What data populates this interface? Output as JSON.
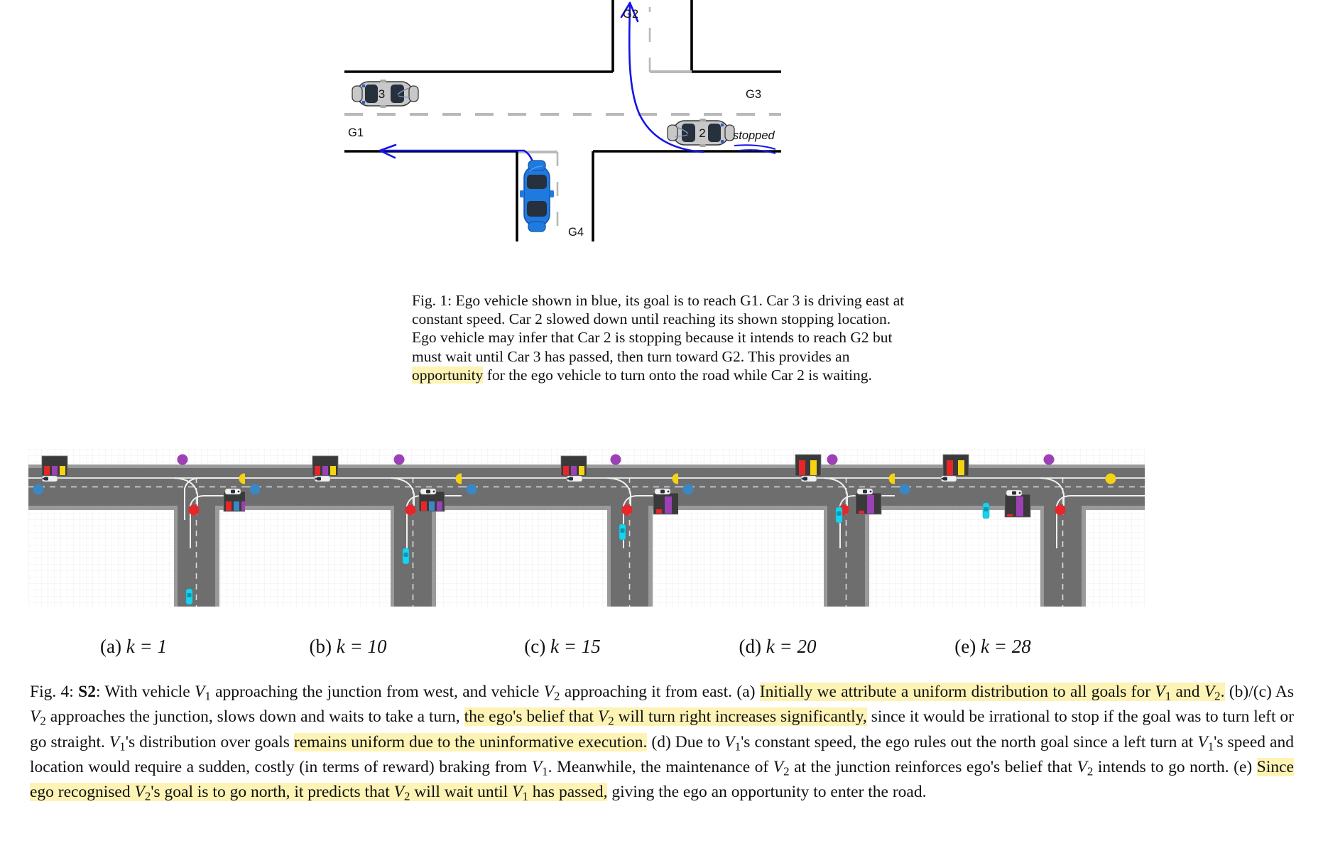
{
  "figure1": {
    "goal_labels": {
      "g1": "G1",
      "g2": "G2",
      "g3": "G3",
      "g4": "G4"
    },
    "cars": [
      {
        "id": "car-3",
        "number": "3",
        "color": "#b8b8b8",
        "heading": "east"
      },
      {
        "id": "car-2",
        "number": "2",
        "color": "#b8b8b8",
        "heading": "west"
      },
      {
        "id": "ego-car",
        "number": "",
        "color": "#1f7ae0",
        "heading": "north"
      }
    ],
    "annotation_stopped": "stopped",
    "arrow_color": "#1414e6",
    "caption": {
      "label": "Fig. 1:",
      "part1": " Ego vehicle shown in blue, its goal is to reach G1. Car 3 is driving east at constant speed. Car 2 slowed down until reaching its shown stopping location. Ego vehicle may infer that Car 2 is stopping because it intends to reach G2 but must wait until Car 3 has passed, then turn toward G2. This provides an ",
      "highlight": "opportunity",
      "part2": " for the ego vehicle to turn onto the road while Car 2 is waiting."
    }
  },
  "figure4": {
    "subcaptions": [
      {
        "tag": "(a)",
        "expr": "k = 1",
        "k": 1
      },
      {
        "tag": "(b)",
        "expr": "k = 10",
        "k": 10
      },
      {
        "tag": "(c)",
        "expr": "k = 15",
        "k": 15
      },
      {
        "tag": "(d)",
        "expr": "k = 20",
        "k": 20
      },
      {
        "tag": "(e)",
        "expr": "k = 28",
        "k": 28
      }
    ],
    "legend_colors": {
      "road": "#6e6e6e",
      "shoulder": "#9a9a9a",
      "lane_marking": "#dcdcdc",
      "ego_vehicle": "#19d2ee",
      "other_vehicle": "#f2f2f2",
      "goal_marker_yellow": "#f5d312",
      "goal_marker_blue": "#3a87c4",
      "goal_marker_red": "#e8262a",
      "goal_marker_purple": "#9c41b5",
      "belief_panel_bg": "#3a3a3a"
    },
    "panels": [
      {
        "name": "panel-a",
        "goals": [
          {
            "name": "goal-north",
            "color": "#9c41b5"
          },
          {
            "name": "goal-east",
            "color": "#f5d312"
          },
          {
            "name": "goal-west",
            "color": "#3a87c4"
          },
          {
            "name": "goal-south",
            "color": "#e8262a"
          }
        ],
        "beliefs_v1": [
          {
            "goal": "red",
            "value": 0.33
          },
          {
            "goal": "purple",
            "value": 0.33
          },
          {
            "goal": "yellow",
            "value": 0.33
          }
        ],
        "beliefs_v2": [
          {
            "goal": "red",
            "value": 0.33
          },
          {
            "goal": "blue",
            "value": 0.33
          },
          {
            "goal": "purple",
            "value": 0.33
          }
        ],
        "v1_x": 0.06,
        "v2_x": 0.8,
        "ego_y": 0.88
      },
      {
        "name": "panel-b",
        "beliefs_v1": [
          {
            "goal": "red",
            "value": 0.33
          },
          {
            "goal": "purple",
            "value": 0.33
          },
          {
            "goal": "yellow",
            "value": 0.33
          }
        ],
        "beliefs_v2": [
          {
            "goal": "red",
            "value": 0.33
          },
          {
            "goal": "blue",
            "value": 0.33
          },
          {
            "goal": "purple",
            "value": 0.33
          }
        ],
        "v1_x": 0.32,
        "v2_x": 0.68,
        "ego_y": 0.64
      },
      {
        "name": "panel-c",
        "beliefs_v1": [
          {
            "goal": "red",
            "value": 0.33
          },
          {
            "goal": "purple",
            "value": 0.33
          },
          {
            "goal": "yellow",
            "value": 0.33
          }
        ],
        "beliefs_v2": [
          {
            "goal": "red",
            "value": 0.18
          },
          {
            "goal": "purple",
            "value": 0.8
          }
        ],
        "v1_x": 0.46,
        "v2_x": 0.58,
        "ego_y": 0.56
      },
      {
        "name": "panel-d",
        "beliefs_v1": [
          {
            "goal": "red",
            "value": 0.5
          },
          {
            "goal": "yellow",
            "value": 0.5
          }
        ],
        "beliefs_v2": [
          {
            "goal": "red",
            "value": 0.16
          },
          {
            "goal": "purple",
            "value": 0.88
          }
        ],
        "v1_x": 0.56,
        "v2_x": 0.56,
        "ego_y": 0.5
      },
      {
        "name": "panel-e",
        "beliefs_v1": [
          {
            "goal": "red",
            "value": 0.52
          },
          {
            "goal": "yellow",
            "value": 0.52
          }
        ],
        "beliefs_v2": [
          {
            "goal": "red",
            "value": 0.12
          },
          {
            "goal": "purple",
            "value": 0.92
          }
        ],
        "v1_x": 0.2,
        "v2_x": 0.46,
        "ego_y": 0.46
      }
    ],
    "caption": {
      "label": "Fig. 4:",
      "bold_tag": "S2",
      "seg1": ": With vehicle ",
      "v1a": "V",
      "v1asub": "1",
      "seg2": " approaching the junction from west, and vehicle ",
      "v2a": "V",
      "v2asub": "2",
      "seg3": " approaching it from east. (a) ",
      "hl1": "Initially we attribute a uniform distribution to all goals for ",
      "hl1_v1": "V",
      "hl1_v1sub": "1",
      "hl1_and": " and ",
      "hl1_v2": "V",
      "hl1_v2sub": "2",
      "hl1_end": ".",
      "seg4": " (b)/(c) As ",
      "v2b": "V",
      "v2bsub": "2",
      "seg5": " approaches the junction, slows down and waits to take a turn, ",
      "hl2a": "the ego's belief that ",
      "hl2_v2": "V",
      "hl2_v2sub": "2",
      "hl2b": " will turn right increases significantly,",
      "seg6": " since it would be irrational to stop if the goal was to turn left or go straight. ",
      "v1c": "V",
      "v1csub": "1",
      "seg7": "'s distribution over goals ",
      "hl3": "remains uniform due to the uninformative execution.",
      "seg8": " (d) Due to ",
      "v1d": "V",
      "v1dsub": "1",
      "seg9": "'s constant speed, the ego rules out the north goal since a left turn at ",
      "v1e": "V",
      "v1esub": "1",
      "seg10": "'s speed and location would require a sudden, costly (in terms of reward) braking from ",
      "v1f": "V",
      "v1fsub": "1",
      "seg11": ". Meanwhile, the maintenance of ",
      "v2c": "V",
      "v2csub": "2",
      "seg12": " at the junction reinforces ego's belief that ",
      "v2d": "V",
      "v2dsub": "2",
      "seg13": " intends to go north. (e) ",
      "hl4a": "Since ego recognised ",
      "hl4_v2": "V",
      "hl4_v2sub": "2",
      "hl4b": "'s goal is to go north, it predicts that ",
      "hl4_v2b": "V",
      "hl4_v2bsub": "2",
      "hl4c": " will wait until ",
      "hl4_v1": "V",
      "hl4_v1sub": "1",
      "hl4d": " has passed,",
      "seg14": " giving the ego an opportunity to enter the road."
    }
  }
}
